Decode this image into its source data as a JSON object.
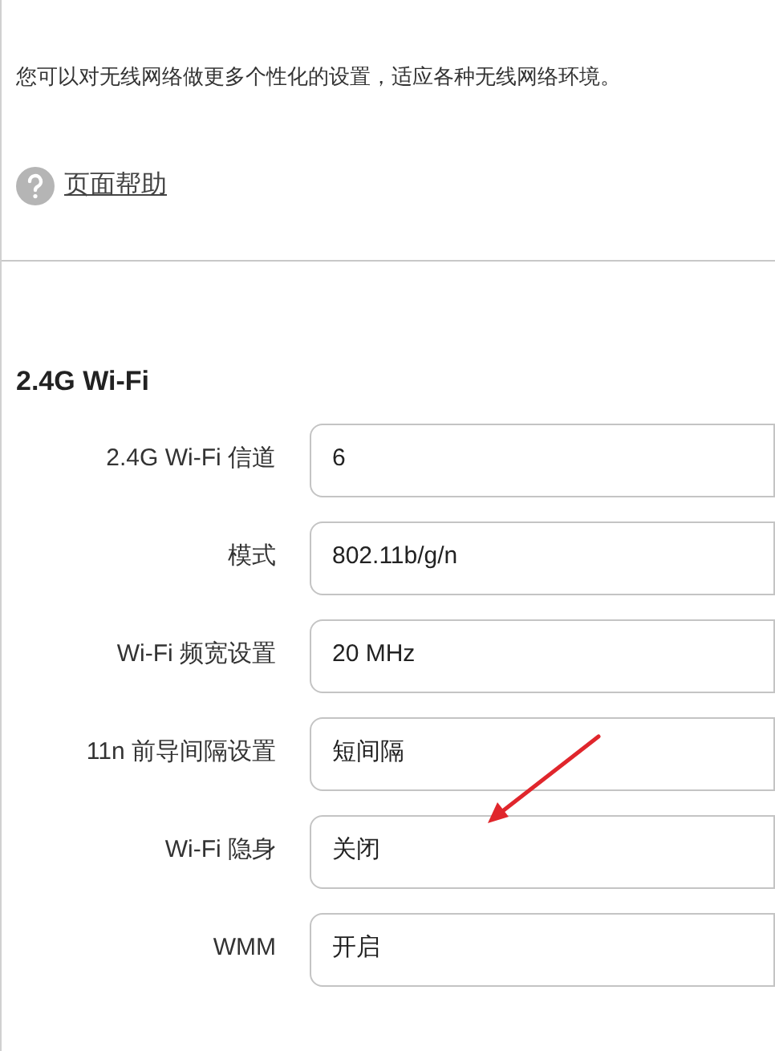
{
  "description": "您可以对无线网络做更多个性化的设置，适应各种无线网络环境。",
  "help_link": "页面帮助",
  "section": {
    "title": "2.4G Wi-Fi",
    "fields": [
      {
        "label": "2.4G Wi-Fi 信道",
        "value": "6"
      },
      {
        "label": "模式",
        "value": "802.11b/g/n"
      },
      {
        "label": "Wi-Fi 频宽设置",
        "value": "20 MHz"
      },
      {
        "label": "11n 前导间隔设置",
        "value": "短间隔"
      },
      {
        "label": "Wi-Fi 隐身",
        "value": "关闭"
      },
      {
        "label": "WMM",
        "value": "开启"
      }
    ]
  }
}
